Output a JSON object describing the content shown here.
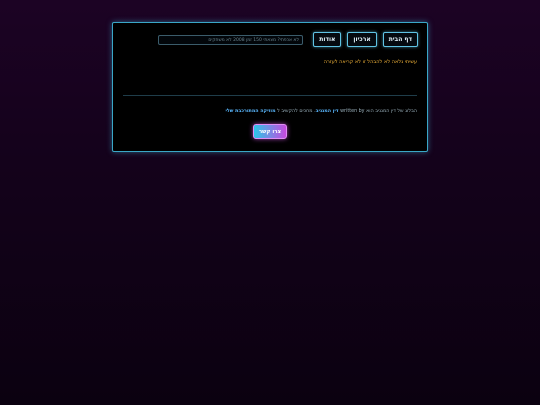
{
  "nav": {
    "items": [
      {
        "label": "דף הבית"
      },
      {
        "label": "ארכיון"
      },
      {
        "label": "אודות"
      }
    ]
  },
  "search": {
    "placeholder": "לא אכפתי? מצאתי 150 זמן 2008 לא משחקים"
  },
  "warning_text": "עשיתי נלאה לא להבהל זו לא קריאה לעזרה",
  "footer": {
    "prefix": "הבלוג של דין המגניב הוא",
    "written": "written",
    "by": "by",
    "author_link": "דין המגניב",
    "middle": ". מחכים להקשיב ל",
    "music_link": "מוזיקה המתורכבת שלי"
  },
  "contact_label": "צרו קשר",
  "colors": {
    "accent": "#5fc3e4",
    "warning": "#f5b63a",
    "link": "#5ab8ff"
  }
}
